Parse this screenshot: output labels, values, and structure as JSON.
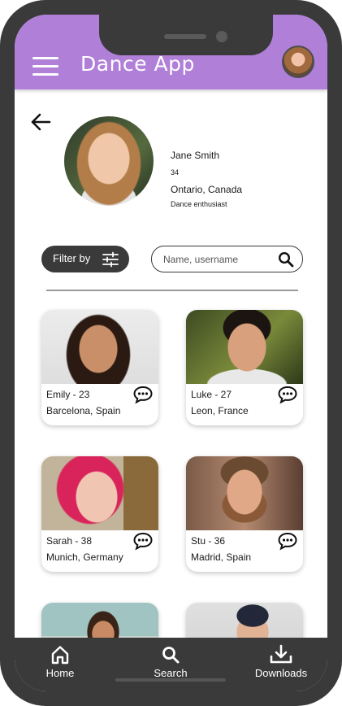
{
  "app": {
    "title": "Dance App"
  },
  "profile": {
    "name": "Jane Smith",
    "age": "34",
    "location": "Ontario, Canada",
    "bio": "Dance enthusiast"
  },
  "filter": {
    "label": "Filter by"
  },
  "search": {
    "placeholder": "Name, username"
  },
  "cards": [
    {
      "name": "Emily - 23",
      "location": "Barcelona, Spain"
    },
    {
      "name": "Luke - 27",
      "location": "Leon, France"
    },
    {
      "name": "Sarah - 38",
      "location": "Munich, Germany"
    },
    {
      "name": "Stu - 36",
      "location": "Madrid, Spain"
    },
    {
      "name": "",
      "location": ""
    },
    {
      "name": "",
      "location": ""
    }
  ],
  "nav": {
    "home": "Home",
    "search": "Search",
    "downloads": "Downloads"
  },
  "colors": {
    "accent": "#b07fd8",
    "frame": "#3a3a3a"
  }
}
